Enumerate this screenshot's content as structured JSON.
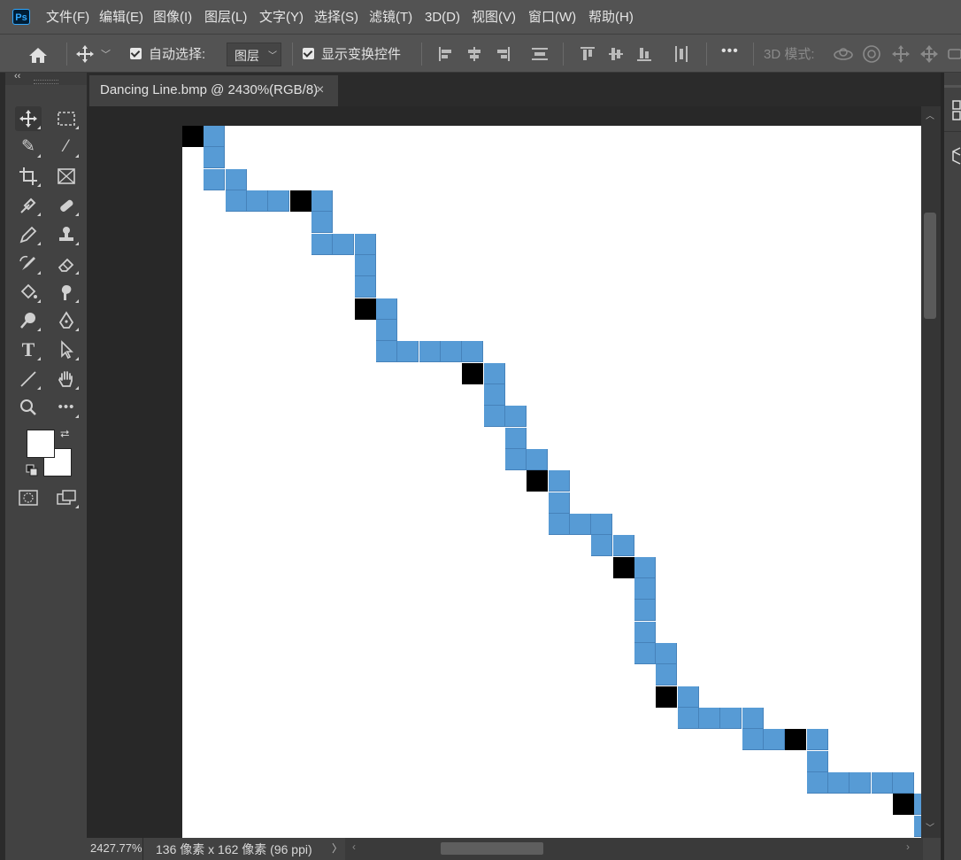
{
  "app": {
    "logo_text": "Ps"
  },
  "menu": [
    "文件(F)",
    "编辑(E)",
    "图像(I)",
    "图层(L)",
    "文字(Y)",
    "选择(S)",
    "滤镜(T)",
    "3D(D)",
    "视图(V)",
    "窗口(W)",
    "帮助(H)"
  ],
  "options": {
    "auto_select_label": "自动选择:",
    "auto_select_checked": true,
    "layer_select_value": "图层",
    "show_transform_label": "显示变换控件",
    "show_transform_checked": true,
    "mode_3d_label": "3D 模式:",
    "more_label": "•••"
  },
  "toolbar": {
    "collapse_label": "‹‹",
    "tools": [
      "move-tool",
      "marquee-tool",
      "quick-select-tool",
      "magic-wand-tool",
      "crop-tool",
      "frame-tool",
      "eyedropper-tool",
      "healing-brush-tool",
      "brush-tool",
      "clone-stamp-tool",
      "history-brush-tool",
      "eraser-tool",
      "paint-bucket-tool",
      "smudge-tool",
      "dodge-tool",
      "pen-tool",
      "type-tool",
      "path-select-tool",
      "line-tool",
      "hand-tool",
      "zoom-tool",
      "more-tools"
    ],
    "foreground_color": "#ffffff",
    "background_color": "#ffffff"
  },
  "document": {
    "tab_title": "Dancing Line.bmp @ 2430%(RGB/8)",
    "close_label": "×"
  },
  "pixel_art": {
    "blue": "#579bd5",
    "black": "#000000",
    "cells": [
      [
        0,
        0,
        "k"
      ],
      [
        1,
        0,
        "b"
      ],
      [
        1,
        1,
        "b"
      ],
      [
        1,
        2,
        "b"
      ],
      [
        2,
        2,
        "b"
      ],
      [
        2,
        3,
        "b"
      ],
      [
        3,
        3,
        "b"
      ],
      [
        4,
        3,
        "b"
      ],
      [
        5,
        3,
        "k"
      ],
      [
        6,
        3,
        "b"
      ],
      [
        6,
        4,
        "b"
      ],
      [
        6,
        5,
        "b"
      ],
      [
        7,
        5,
        "b"
      ],
      [
        8,
        5,
        "b"
      ],
      [
        8,
        6,
        "b"
      ],
      [
        8,
        7,
        "b"
      ],
      [
        8,
        8,
        "k"
      ],
      [
        9,
        8,
        "b"
      ],
      [
        9,
        9,
        "b"
      ],
      [
        9,
        10,
        "b"
      ],
      [
        10,
        10,
        "b"
      ],
      [
        11,
        10,
        "b"
      ],
      [
        12,
        10,
        "b"
      ],
      [
        13,
        10,
        "b"
      ],
      [
        13,
        11,
        "k"
      ],
      [
        14,
        11,
        "b"
      ],
      [
        14,
        12,
        "b"
      ],
      [
        14,
        13,
        "b"
      ],
      [
        15,
        13,
        "b"
      ],
      [
        15,
        14,
        "b"
      ],
      [
        15,
        15,
        "b"
      ],
      [
        16,
        15,
        "b"
      ],
      [
        16,
        16,
        "k"
      ],
      [
        17,
        16,
        "b"
      ],
      [
        17,
        17,
        "b"
      ],
      [
        17,
        18,
        "b"
      ],
      [
        18,
        18,
        "b"
      ],
      [
        19,
        18,
        "b"
      ],
      [
        19,
        19,
        "b"
      ],
      [
        20,
        19,
        "b"
      ],
      [
        20,
        20,
        "k"
      ],
      [
        21,
        20,
        "b"
      ],
      [
        21,
        21,
        "b"
      ],
      [
        21,
        22,
        "b"
      ],
      [
        21,
        23,
        "b"
      ],
      [
        21,
        24,
        "b"
      ],
      [
        22,
        24,
        "b"
      ],
      [
        22,
        25,
        "b"
      ],
      [
        22,
        26,
        "k"
      ],
      [
        23,
        26,
        "b"
      ],
      [
        23,
        27,
        "b"
      ],
      [
        24,
        27,
        "b"
      ],
      [
        25,
        27,
        "b"
      ],
      [
        26,
        27,
        "b"
      ],
      [
        26,
        28,
        "b"
      ],
      [
        27,
        28,
        "b"
      ],
      [
        28,
        28,
        "k"
      ],
      [
        29,
        28,
        "b"
      ],
      [
        29,
        29,
        "b"
      ],
      [
        29,
        30,
        "b"
      ],
      [
        30,
        30,
        "b"
      ],
      [
        31,
        30,
        "b"
      ],
      [
        32,
        30,
        "b"
      ],
      [
        33,
        30,
        "b"
      ],
      [
        33,
        31,
        "k"
      ],
      [
        34,
        31,
        "b"
      ],
      [
        34,
        32,
        "b"
      ]
    ]
  },
  "status": {
    "zoom": "2427.77%",
    "doc_info": "136 像素 x 162 像素 (96 ppi)",
    "arrow": "〉"
  }
}
